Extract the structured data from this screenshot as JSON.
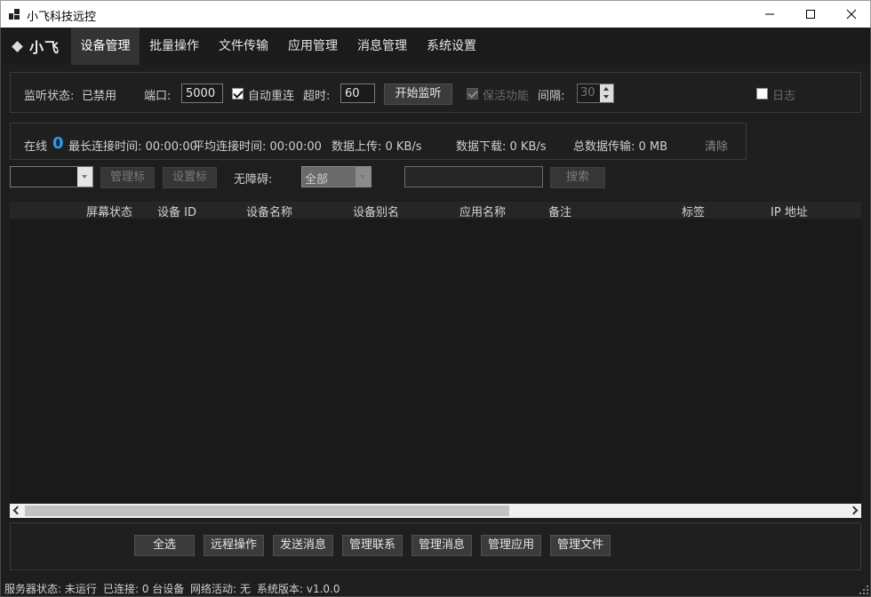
{
  "window": {
    "title": "小飞科技远控",
    "icons": {
      "app": "app-logo-icon",
      "minimize": "minimize-icon",
      "maximize": "maximize-icon",
      "close": "close-icon"
    }
  },
  "nav": {
    "logo_text": "小飞",
    "tabs": [
      {
        "label": "设备管理",
        "active": true
      },
      {
        "label": "批量操作",
        "active": false
      },
      {
        "label": "文件传输",
        "active": false
      },
      {
        "label": "应用管理",
        "active": false
      },
      {
        "label": "消息管理",
        "active": false
      },
      {
        "label": "系统设置",
        "active": false
      }
    ]
  },
  "listen": {
    "status_label": "监听状态:",
    "status_value": "已禁用",
    "port_label": "端口:",
    "port_value": "5000",
    "auto_reconnect_label": "自动重连",
    "auto_reconnect_checked": true,
    "timeout_label": "超时:",
    "timeout_value": "60",
    "start_button": "开始监听",
    "keepalive_label": "保活功能",
    "keepalive_checked": true,
    "interval_label": "间隔:",
    "interval_value": "30",
    "log_label": "日志",
    "log_checked": false
  },
  "stats": {
    "online_label": "在线",
    "online_count": "0",
    "longest_label": "最长连接时间: 00:00:00",
    "average_label": "平均连接时间: 00:00:00",
    "upload_label": "数据上传: 0 KB/s",
    "download_label": "数据下载: 0 KB/s",
    "total_label": "总数据传输: 0 MB",
    "clear_button": "清除",
    "online_color": "#2e9bef"
  },
  "filter": {
    "group_select_value": "",
    "manage_tags_button": "管理标",
    "set_tags_button": "设置标",
    "accessibility_label": "无障碍:",
    "accessibility_value": "全部",
    "search_value": "",
    "search_button": "搜索"
  },
  "table": {
    "columns": [
      "屏幕状态",
      "设备 ID",
      "设备名称",
      "设备别名",
      "应用名称",
      "备注",
      "标签",
      "IP 地址"
    ],
    "rows": []
  },
  "actions": {
    "buttons": [
      "全选",
      "远程操作",
      "发送消息",
      "管理联系",
      "管理消息",
      "管理应用",
      "管理文件"
    ]
  },
  "statusbar": {
    "server_status": "服务器状态: 未运行",
    "connected": "已连接: 0 台设备",
    "network": "网络活动: 无",
    "version": "系统版本: v1.0.0"
  }
}
